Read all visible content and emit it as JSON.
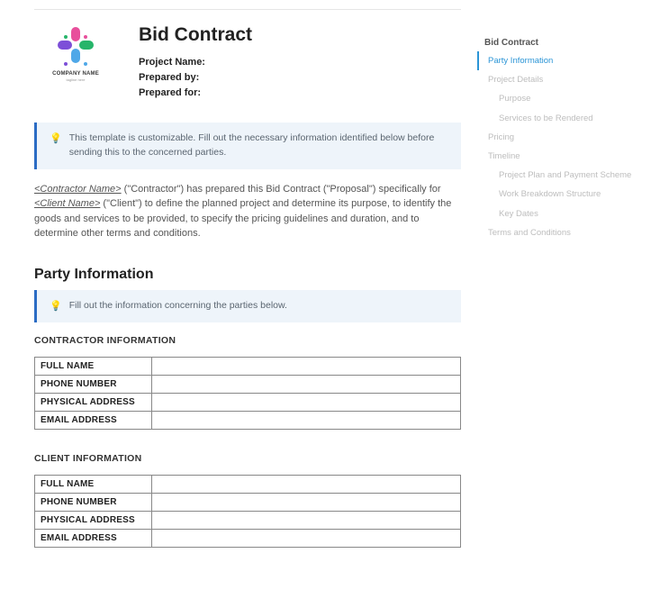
{
  "logo": {
    "company": "COMPANY NAME",
    "tagline": "tagline here"
  },
  "header": {
    "title": "Bid Contract",
    "meta": {
      "project_name_label": "Project Name:",
      "prepared_by_label": "Prepared by:",
      "prepared_for_label": "Prepared for:"
    }
  },
  "callout_top": "This template is customizable. Fill out the necessary information identified below before sending this to the concerned parties.",
  "intro": {
    "contractor_ph": "<Contractor Name>",
    "text1": " (\"Contractor\") has prepared this Bid Contract (\"Proposal\") specifically for ",
    "client_ph": "<Client Name>",
    "text2": " (\"Client\") to define the planned project and determine its purpose, to identify the goods and services to be provided, to specify the pricing guidelines and duration, and to determine other terms and conditions."
  },
  "section": {
    "party_info_heading": "Party Information",
    "party_callout": "Fill out the information concerning the parties below.",
    "contractor_heading": "CONTRACTOR INFORMATION",
    "client_heading": "CLIENT INFORMATION",
    "rows": [
      "FULL NAME",
      "PHONE NUMBER",
      "PHYSICAL ADDRESS",
      "EMAIL ADDRESS"
    ]
  },
  "nav": {
    "root": "Bid Contract",
    "items": [
      {
        "label": "Party Information",
        "level": 1,
        "active": true
      },
      {
        "label": "Project Details",
        "level": 1,
        "active": false
      },
      {
        "label": "Purpose",
        "level": 2,
        "active": false
      },
      {
        "label": "Services to be Rendered",
        "level": 2,
        "active": false
      },
      {
        "label": "Pricing",
        "level": 1,
        "active": false
      },
      {
        "label": "Timeline",
        "level": 1,
        "active": false
      },
      {
        "label": "Project Plan and Payment Scheme",
        "level": 2,
        "active": false
      },
      {
        "label": "Work Breakdown Structure",
        "level": 2,
        "active": false
      },
      {
        "label": "Key Dates",
        "level": 2,
        "active": false
      },
      {
        "label": "Terms and Conditions",
        "level": 1,
        "active": false
      }
    ]
  }
}
